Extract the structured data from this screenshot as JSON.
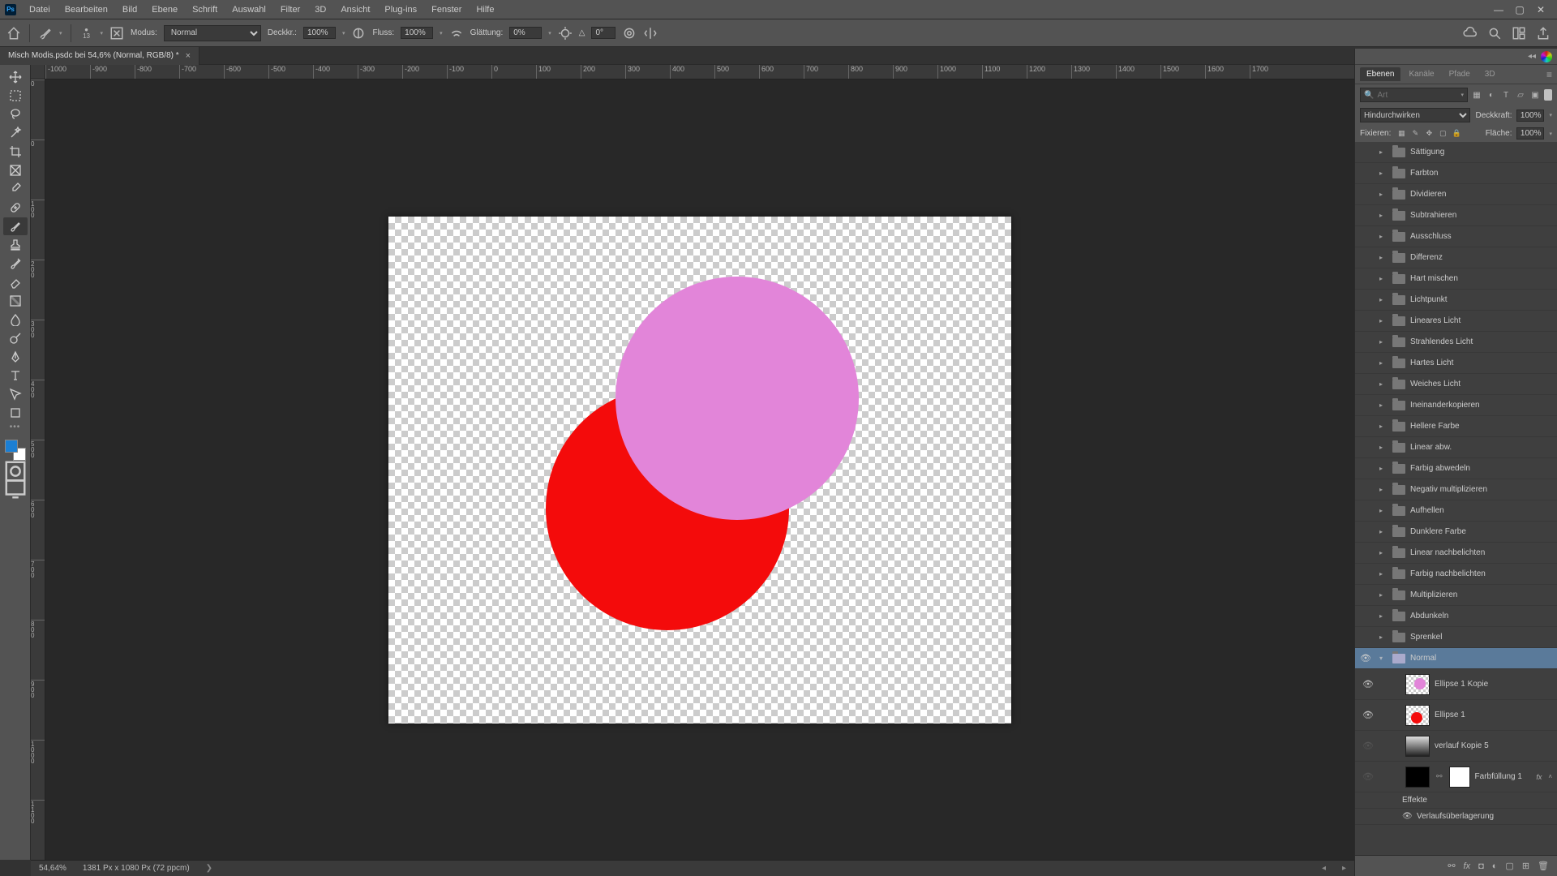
{
  "menu": [
    "Datei",
    "Bearbeiten",
    "Bild",
    "Ebene",
    "Schrift",
    "Auswahl",
    "Filter",
    "3D",
    "Ansicht",
    "Plug-ins",
    "Fenster",
    "Hilfe"
  ],
  "optbar": {
    "brush_size": "13",
    "modus_label": "Modus:",
    "modus_value": "Normal",
    "deckk_label": "Deckkr.:",
    "deckk_value": "100%",
    "fluss_label": "Fluss:",
    "fluss_value": "100%",
    "glatt_label": "Glättung:",
    "glatt_value": "0%",
    "angle_label": "△",
    "angle_value": "0°"
  },
  "doc_tab": "Misch Modis.psdc bei 54,6% (Normal, RGB/8) *",
  "ruler_h": [
    "-1000",
    "-900",
    "-800",
    "-700",
    "-600",
    "-500",
    "-400",
    "-300",
    "-200",
    "-100",
    "0",
    "100",
    "200",
    "300",
    "400",
    "500",
    "600",
    "700",
    "800",
    "900",
    "1000",
    "1100",
    "1200",
    "1300",
    "1400",
    "1500",
    "1600",
    "1700"
  ],
  "ruler_v": [
    "0",
    "0",
    "1 0 0",
    "2 0 0",
    "3 0 0",
    "4 0 0",
    "5 0 0",
    "6 0 0",
    "7 0 0",
    "8 0 0",
    "9 0 0",
    "1 0 0 0",
    "1 1 0 0"
  ],
  "panel_tabs": [
    "Ebenen",
    "Kanäle",
    "Pfade",
    "3D"
  ],
  "search_placeholder": "Art",
  "blend_mode": "Hindurchwirken",
  "deckk_lbl": "Deckkraft:",
  "deckk_val": "100%",
  "lock_lbl": "Fixieren:",
  "fill_lbl": "Fläche:",
  "fill_val": "100%",
  "groups": [
    "Sättigung",
    "Farbton",
    "Dividieren",
    "Subtrahieren",
    "Ausschluss",
    "Differenz",
    "Hart mischen",
    "Lichtpunkt",
    "Lineares Licht",
    "Strahlendes Licht",
    "Hartes Licht",
    "Weiches Licht",
    "Ineinanderkopieren",
    "Hellere Farbe",
    "Linear abw.",
    "Farbig abwedeln",
    "Negativ multiplizieren",
    "Aufhellen",
    "Dunklere Farbe",
    "Linear nachbelichten",
    "Farbig nachbelichten",
    "Multiplizieren",
    "Abdunkeln",
    "Sprenkel"
  ],
  "active_group": "Normal",
  "layers": {
    "ellipse_copy": "Ellipse 1 Kopie",
    "ellipse": "Ellipse 1",
    "verlauf": "verlauf Kopie 5",
    "fill": "Farbfüllung 1",
    "effects": "Effekte",
    "grad_overlay": "Verlaufsüberlagerung"
  },
  "status": {
    "zoom": "54,64%",
    "info": "1381 Px x 1080 Px (72 ppcm)"
  }
}
